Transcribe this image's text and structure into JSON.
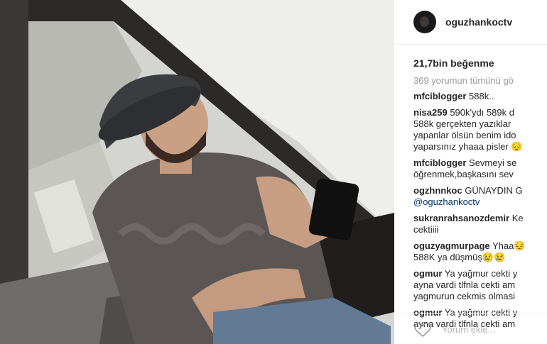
{
  "post": {
    "username": "oguzhankoctv",
    "likes": "21,7bin beğenme",
    "view_all_comments": "369 yorumun tümünü gö"
  },
  "comments": [
    {
      "user": "mfciblogger",
      "lines": [
        "588k.."
      ]
    },
    {
      "user": "nisa259",
      "lines": [
        "590k'ydı 589k d",
        "588k gerçekten yazıklar",
        "yapanlar ölsün benim ido",
        "yaparsınız yhaaa pisler 😔"
      ]
    },
    {
      "user": "mfciblogger",
      "lines": [
        "Sevmeyi se",
        "öğrenmek,başkasını sev"
      ]
    },
    {
      "user": "ogzhnnkoc",
      "lines": [
        "GÜNAYDIN G",
        "@oguzhankoctv"
      ]
    },
    {
      "user": "sukranrahsanozdemir",
      "lines": [
        "Ke",
        "cektiiii"
      ]
    },
    {
      "user": "oguzyagmurpage",
      "lines": [
        "Yhaa😔",
        "588K ya düşmüş😢😢"
      ]
    },
    {
      "user": "ogmur",
      "lines": [
        "Ya yağmur cekti y",
        "ayna vardi tlfnla cekti am",
        "yagmurun cekmis olmasi"
      ]
    },
    {
      "user": "ogmur",
      "lines": [
        "Ya yağmur cekti y",
        "ayna vardi tlfnla cekti am"
      ]
    }
  ],
  "footer": {
    "add_comment_placeholder": "Yorum ekle...",
    "like_icon": "heart-outline-icon"
  },
  "colors": {
    "text": "#262626",
    "muted": "#999999",
    "mention": "#003569",
    "border": "#efefef"
  }
}
